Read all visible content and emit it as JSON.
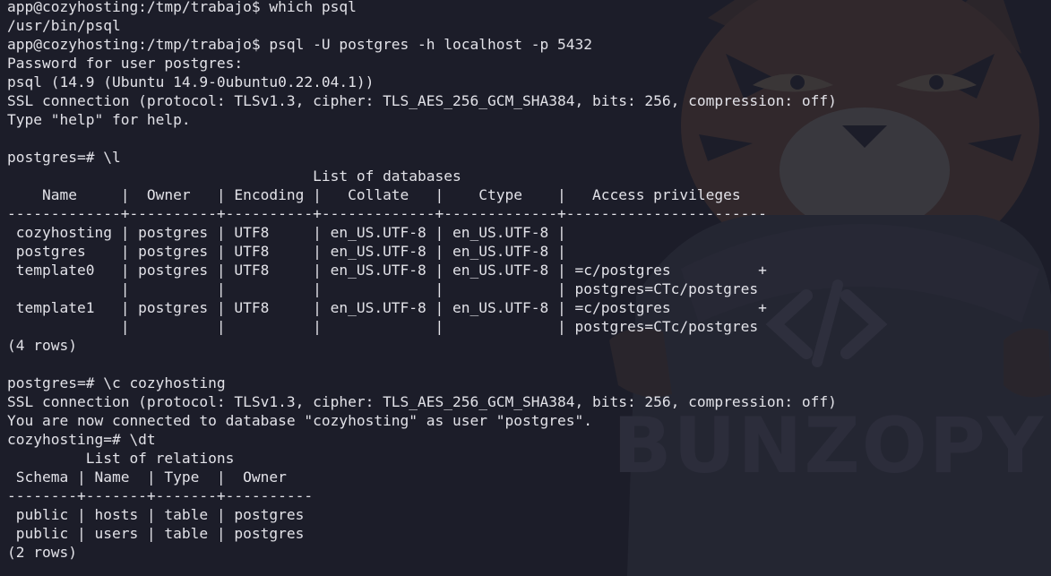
{
  "terminal": {
    "watermark_text": "BUNZOPY",
    "colors": {
      "background": "#1c1d29",
      "text": "#e2e2e8",
      "watermark": "#2c2d3b"
    },
    "lines": [
      "app@cozyhosting:/tmp/trabajo$ which psql",
      "/usr/bin/psql",
      "app@cozyhosting:/tmp/trabajo$ psql -U postgres -h localhost -p 5432",
      "Password for user postgres:",
      "psql (14.9 (Ubuntu 14.9-0ubuntu0.22.04.1))",
      "SSL connection (protocol: TLSv1.3, cipher: TLS_AES_256_GCM_SHA384, bits: 256, compression: off)",
      "Type \"help\" for help.",
      "",
      "postgres=# \\l",
      "                                   List of databases",
      "    Name     |  Owner   | Encoding |   Collate   |    Ctype    |   Access privileges",
      "-------------+----------+----------+-------------+-------------+-----------------------",
      " cozyhosting | postgres | UTF8     | en_US.UTF-8 | en_US.UTF-8 |",
      " postgres    | postgres | UTF8     | en_US.UTF-8 | en_US.UTF-8 |",
      " template0   | postgres | UTF8     | en_US.UTF-8 | en_US.UTF-8 | =c/postgres          +",
      "             |          |          |             |             | postgres=CTc/postgres",
      " template1   | postgres | UTF8     | en_US.UTF-8 | en_US.UTF-8 | =c/postgres          +",
      "             |          |          |             |             | postgres=CTc/postgres",
      "(4 rows)",
      "",
      "postgres=# \\c cozyhosting",
      "SSL connection (protocol: TLSv1.3, cipher: TLS_AES_256_GCM_SHA384, bits: 256, compression: off)",
      "You are now connected to database \"cozyhosting\" as user \"postgres\".",
      "cozyhosting=# \\dt",
      "         List of relations",
      " Schema | Name  | Type  |  Owner",
      "--------+-------+-------+----------",
      " public | hosts | table | postgres",
      " public | users | table | postgres",
      "(2 rows)"
    ]
  }
}
